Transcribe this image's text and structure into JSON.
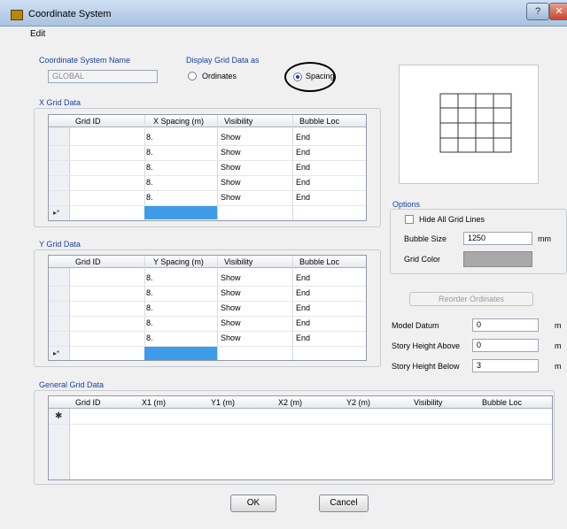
{
  "window": {
    "title": "Coordinate System",
    "help_label": "?",
    "close_label": "✕"
  },
  "menu": {
    "items": [
      "Edit"
    ]
  },
  "coord_system": {
    "label": "Coordinate System Name",
    "value": "GLOBAL"
  },
  "display_grid": {
    "label": "Display Grid Data as",
    "options": [
      "Ordinates",
      "Spacing"
    ],
    "selected": "Spacing"
  },
  "x_grid": {
    "title": "X Grid Data",
    "columns": [
      "Grid ID",
      "X Spacing  (m)",
      "Visibility",
      "Bubble Loc"
    ],
    "rows": [
      [
        "",
        "8.",
        "Show",
        "End"
      ],
      [
        "",
        "8.",
        "Show",
        "End"
      ],
      [
        "",
        "8.",
        "Show",
        "End"
      ],
      [
        "",
        "8.",
        "Show",
        "End"
      ],
      [
        "",
        "8.",
        "Show",
        "End"
      ]
    ],
    "new_row_marker": "▸*"
  },
  "y_grid": {
    "title": "Y Grid Data",
    "columns": [
      "Grid ID",
      "Y Spacing  (m)",
      "Visibility",
      "Bubble Loc"
    ],
    "rows": [
      [
        "",
        "8.",
        "Show",
        "End"
      ],
      [
        "",
        "8.",
        "Show",
        "End"
      ],
      [
        "",
        "8.",
        "Show",
        "End"
      ],
      [
        "",
        "8.",
        "Show",
        "End"
      ],
      [
        "",
        "8.",
        "Show",
        "End"
      ]
    ],
    "new_row_marker": "▸*"
  },
  "general_grid": {
    "title": "General Grid Data",
    "columns": [
      "Grid ID",
      "X1  (m)",
      "Y1  (m)",
      "X2  (m)",
      "Y2  (m)",
      "Visibility",
      "Bubble Loc"
    ],
    "new_row_marker": "✱"
  },
  "options": {
    "title": "Options",
    "hide_grid_lines": "Hide All Grid Lines",
    "bubble_size_label": "Bubble Size",
    "bubble_size_value": "1250",
    "bubble_size_unit": "mm",
    "grid_color_label": "Grid Color",
    "grid_color": "#a9a9a9"
  },
  "reorder_button": "Reorder Ordinates",
  "datum": {
    "model_datum_label": "Model Datum",
    "model_datum_value": "0",
    "model_datum_unit": "m",
    "story_above_label": "Story Height Above",
    "story_above_value": "0",
    "story_above_unit": "m",
    "story_below_label": "Story Height Below",
    "story_below_value": "3",
    "story_below_unit": "m"
  },
  "buttons": {
    "ok": "OK",
    "cancel": "Cancel"
  },
  "colors": {
    "accent_blue": "#3f9be8",
    "label_blue": "#1a3fa5"
  }
}
